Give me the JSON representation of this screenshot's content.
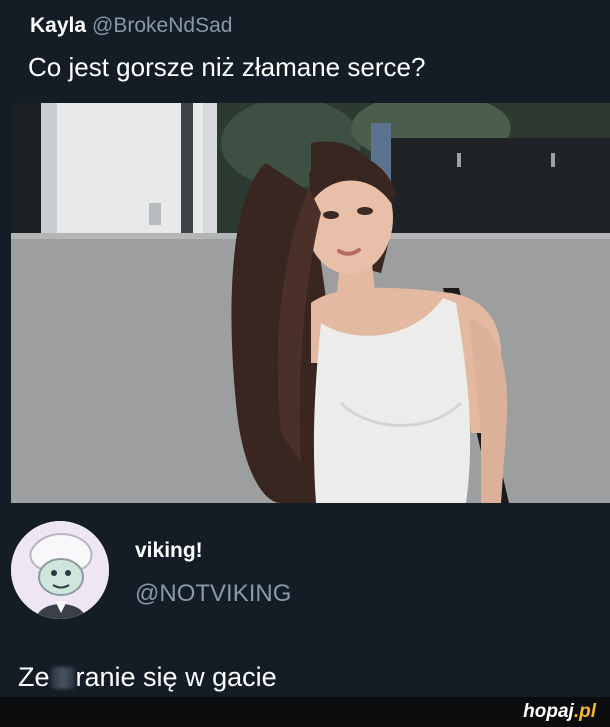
{
  "tweet": {
    "author_name": "Kayla",
    "author_handle": "@BrokeNdSad",
    "text": "Co jest gorsze niż złamane serce?",
    "photo": "woman-in-white-tank-top-photo"
  },
  "reply": {
    "avatar": "cartoon-avatar",
    "name": "viking!",
    "handle": "@NOTVIKING",
    "text_before": "Ze",
    "text_after": "ranie się w gacie"
  },
  "watermark": {
    "brand": "hopaj",
    "domain": ".pl"
  },
  "colors": {
    "background": "#141d26",
    "secondary_text": "#8899a6",
    "watermark_accent": "#f5b52e"
  }
}
